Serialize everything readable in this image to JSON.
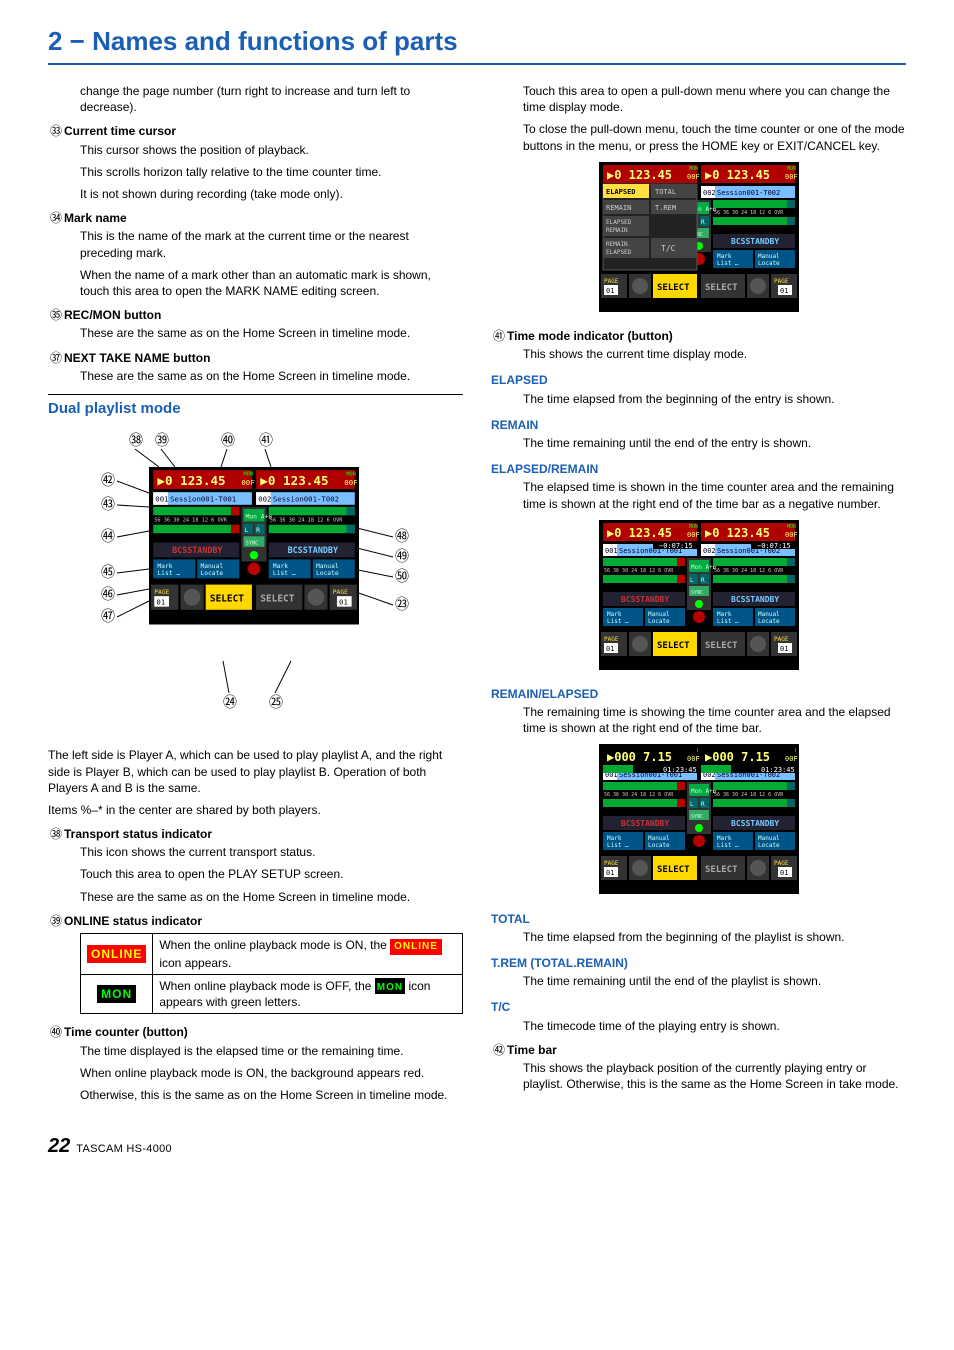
{
  "chapter_title": "2 − Names and functions of parts",
  "left": {
    "continuation": "change the page number (turn right to increase and turn left to decrease).",
    "i34": {
      "num": "㉝",
      "title": "Current time cursor",
      "p": [
        "This cursor shows the position of playback.",
        "This scrolls horizon tally relative to the time counter time.",
        "It is not shown during recording (take mode only)."
      ]
    },
    "i35": {
      "num": "㉞",
      "title": "Mark name",
      "p": [
        "This is the name of the mark at the current time or the nearest preceding mark.",
        "When the name of a mark other than an automatic mark is shown, touch this area to open the MARK NAME editing screen."
      ]
    },
    "i36": {
      "num": "㉟",
      "title": "REC/MON button",
      "p": [
        "These are the same as on the Home Screen in timeline mode."
      ]
    },
    "i37": {
      "num": "㊲",
      "title": "NEXT TAKE NAME button",
      "p": [
        "These are the same as on the Home Screen in timeline mode."
      ]
    },
    "section": "Dual playlist mode",
    "fig_intro": [
      "The left side is Player A, which can be used to play playlist A, and the right side is Player B, which can be used to play playlist B. Operation of both Players A and B is the same.",
      "Items %–* in the center are shared by both players."
    ],
    "i38": {
      "num": "㊳",
      "title": "Transport status indicator",
      "p": [
        "This icon shows the current transport status.",
        "Touch this area to open the PLAY SETUP screen.",
        "These are the same as on the Home Screen in timeline mode."
      ]
    },
    "i39": {
      "num": "㊴",
      "title": "ONLINE status indicator"
    },
    "online_table": {
      "r1_badge": "ONLINE",
      "r1_text_a": "When the online playback mode is ON, the ",
      "r1_text_b": " icon appears.",
      "r2_text_a": "When online playback mode is OFF, the ",
      "r2_badge": "MON",
      "r2_text_b": " icon appears with green letters."
    },
    "i40": {
      "num": "㊵",
      "title": "Time counter (button)",
      "p": [
        "The time displayed is the elapsed time or the remaining time.",
        "When online playback mode is ON, the background appears red.",
        "Otherwise, this is the same as on the Home Screen in timeline mode."
      ]
    }
  },
  "right": {
    "continuation": [
      "Touch this area to open a pull-down menu where you can change the time display mode.",
      "To close the pull-down menu, touch the time counter or one of the mode buttons in the menu, or press the HOME key or EXIT/CANCEL key."
    ],
    "i41": {
      "num": "㊶",
      "title": "Time mode indicator (button)",
      "p": [
        "This shows the current time display mode."
      ]
    },
    "elapsed": {
      "h": "ELAPSED",
      "p": "The time elapsed from the beginning of the entry is shown."
    },
    "remain": {
      "h": "REMAIN",
      "p": "The time remaining until the end of the entry is shown."
    },
    "elapsed_remain": {
      "h": "ELAPSED/REMAIN",
      "p": "The elapsed time is shown in the time counter area and the remaining time is shown at the right end of the time bar as a negative number."
    },
    "remain_elapsed": {
      "h": "REMAIN/ELAPSED",
      "p": "The remaining time is showing the time counter area and the elapsed time is shown at the right end of the time bar."
    },
    "total": {
      "h": "TOTAL",
      "p": "The time elapsed from the beginning of the playlist is shown."
    },
    "trem": {
      "h": "T.REM (TOTAL.REMAIN)",
      "p": "The time remaining until the end of the playlist is shown."
    },
    "tc": {
      "h": "T/C",
      "p": "The timecode time of the playing entry is shown."
    },
    "i42": {
      "num": "㊷",
      "title": "Time bar",
      "p": [
        "This shows the playback position of the currently playing entry or playlist. Otherwise, this is the same as the Home Screen in take mode."
      ]
    }
  },
  "screenshots": {
    "menu_labels": [
      "ELAPSED",
      "TOTAL",
      "REMAIN",
      "T.REM",
      "ELAPSED REMAIN",
      "REMAIN ELAPSED",
      "T/C"
    ],
    "session_a": "001 Session001-T001",
    "session_b": "002 Session001-T002",
    "session_b_alt": "002 Session001-T002",
    "btns": {
      "mark": "Mark List",
      "manual": "Manual Locate",
      "select": "SELECT",
      "page": "PAGE",
      "page_num": "01"
    },
    "status": "BCSSTANDBY",
    "mon": "Mon A+B",
    "rec": "REC",
    "time_big": "0 123.45",
    "frame": "00F",
    "eltime": "−0:07:15",
    "rmtime": "01:23:45",
    "ticks": "56 36 30 24 18 12 6  OVR"
  },
  "footer": {
    "page": "22",
    "model": "TASCAM  HS-4000"
  }
}
